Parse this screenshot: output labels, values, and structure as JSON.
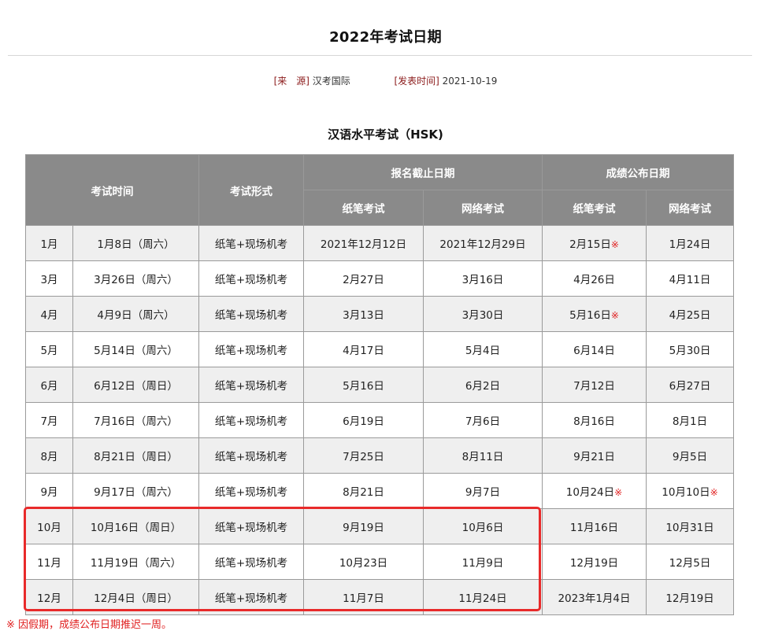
{
  "page_title": "2022年考试日期",
  "meta": {
    "source_label": "[来　源]",
    "source_value": "汉考国际",
    "published_label": "[发表时间]",
    "published_value": "2021-10-19"
  },
  "section_title": "汉语水平考试（HSK)",
  "table": {
    "headers": {
      "exam_time": "考试时间",
      "exam_format": "考试形式",
      "registration_deadline": "报名截止日期",
      "score_release": "成绩公布日期",
      "paper_exam": "纸笔考试",
      "online_exam": "网络考试"
    },
    "rows": [
      {
        "month": "1月",
        "date": "1月8日（周六）",
        "format": "纸笔+现场机考",
        "reg_paper": "2021年12月12日",
        "reg_online": "2021年12月29日",
        "score_paper": "2月15日",
        "score_paper_mark": "※",
        "score_online": "1月24日",
        "score_online_mark": ""
      },
      {
        "month": "3月",
        "date": "3月26日（周六）",
        "format": "纸笔+现场机考",
        "reg_paper": "2月27日",
        "reg_online": "3月16日",
        "score_paper": "4月26日",
        "score_paper_mark": "",
        "score_online": "4月11日",
        "score_online_mark": ""
      },
      {
        "month": "4月",
        "date": "4月9日（周六）",
        "format": "纸笔+现场机考",
        "reg_paper": "3月13日",
        "reg_online": "3月30日",
        "score_paper": "5月16日",
        "score_paper_mark": "※",
        "score_online": "4月25日",
        "score_online_mark": ""
      },
      {
        "month": "5月",
        "date": "5月14日（周六）",
        "format": "纸笔+现场机考",
        "reg_paper": "4月17日",
        "reg_online": "5月4日",
        "score_paper": "6月14日",
        "score_paper_mark": "",
        "score_online": "5月30日",
        "score_online_mark": ""
      },
      {
        "month": "6月",
        "date": "6月12日（周日）",
        "format": "纸笔+现场机考",
        "reg_paper": "5月16日",
        "reg_online": "6月2日",
        "score_paper": "7月12日",
        "score_paper_mark": "",
        "score_online": "6月27日",
        "score_online_mark": ""
      },
      {
        "month": "7月",
        "date": "7月16日（周六）",
        "format": "纸笔+现场机考",
        "reg_paper": "6月19日",
        "reg_online": "7月6日",
        "score_paper": "8月16日",
        "score_paper_mark": "",
        "score_online": "8月1日",
        "score_online_mark": ""
      },
      {
        "month": "8月",
        "date": "8月21日（周日）",
        "format": "纸笔+现场机考",
        "reg_paper": "7月25日",
        "reg_online": "8月11日",
        "score_paper": "9月21日",
        "score_paper_mark": "",
        "score_online": "9月5日",
        "score_online_mark": ""
      },
      {
        "month": "9月",
        "date": "9月17日（周六）",
        "format": "纸笔+现场机考",
        "reg_paper": "8月21日",
        "reg_online": "9月7日",
        "score_paper": "10月24日",
        "score_paper_mark": "※",
        "score_online": "10月10日",
        "score_online_mark": "※"
      },
      {
        "month": "10月",
        "date": "10月16日（周日）",
        "format": "纸笔+现场机考",
        "reg_paper": "9月19日",
        "reg_online": "10月6日",
        "score_paper": "11月16日",
        "score_paper_mark": "",
        "score_online": "10月31日",
        "score_online_mark": ""
      },
      {
        "month": "11月",
        "date": "11月19日（周六）",
        "format": "纸笔+现场机考",
        "reg_paper": "10月23日",
        "reg_online": "11月9日",
        "score_paper": "12月19日",
        "score_paper_mark": "",
        "score_online": "12月5日",
        "score_online_mark": ""
      },
      {
        "month": "12月",
        "date": "12月4日（周日）",
        "format": "纸笔+现场机考",
        "reg_paper": "11月7日",
        "reg_online": "11月24日",
        "score_paper": "2023年1月4日",
        "score_paper_mark": "",
        "score_online": "12月19日",
        "score_online_mark": ""
      }
    ]
  },
  "footnote": "※ 因假期，成绩公布日期推迟一周。",
  "colors": {
    "header_bg": "#8a8a8a",
    "row_alt_bg": "#efefef",
    "highlight_border": "#e82a2a",
    "mark": "#e02020",
    "meta_label": "#8b1a1a"
  }
}
